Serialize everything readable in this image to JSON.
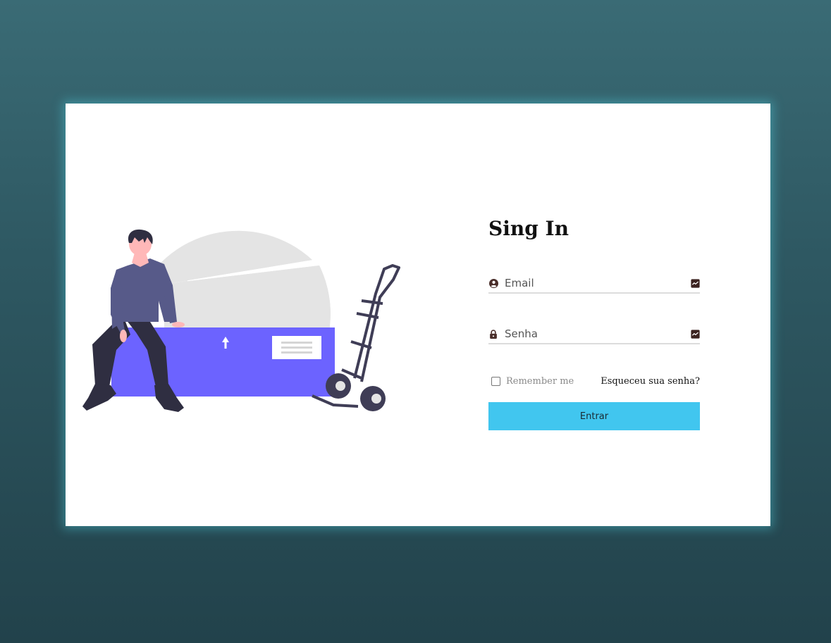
{
  "login": {
    "title": "Sing In",
    "email": {
      "placeholder": "Email",
      "value": "",
      "icon": "user-circle-icon",
      "trailing_icon": "autofill-icon"
    },
    "password": {
      "placeholder": "Senha",
      "value": "",
      "icon": "lock-icon",
      "trailing_icon": "autofill-icon"
    },
    "remember_label": "Remember me",
    "remember_checked": false,
    "forgot_label": "Esqueceu sua senha?",
    "submit_label": "Entrar"
  },
  "colors": {
    "background_top": "#3a6b75",
    "background_bottom": "#22424b",
    "card_glow": "#4dc8d6",
    "button": "#41c6ef",
    "illustration_accent": "#6c63ff"
  }
}
